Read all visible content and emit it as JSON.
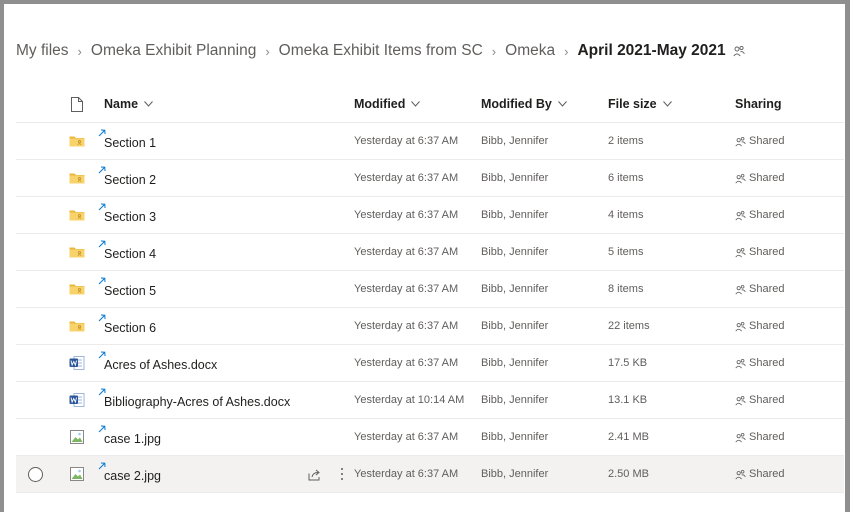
{
  "breadcrumb": {
    "items": [
      "My files",
      "Omeka Exhibit Planning",
      "Omeka Exhibit Items from SC",
      "Omeka"
    ],
    "current": "April 2021-May 2021"
  },
  "columns": {
    "name": "Name",
    "modified": "Modified",
    "modified_by": "Modified By",
    "file_size": "File size",
    "sharing": "Sharing"
  },
  "files": [
    {
      "name": "Section 1",
      "type": "folder",
      "modified": "Yesterday at 6:37 AM",
      "modified_by": "Bibb, Jennifer",
      "size": "2 items",
      "sharing": "Shared"
    },
    {
      "name": "Section 2",
      "type": "folder",
      "modified": "Yesterday at 6:37 AM",
      "modified_by": "Bibb, Jennifer",
      "size": "6 items",
      "sharing": "Shared"
    },
    {
      "name": "Section 3",
      "type": "folder",
      "modified": "Yesterday at 6:37 AM",
      "modified_by": "Bibb, Jennifer",
      "size": "4 items",
      "sharing": "Shared"
    },
    {
      "name": "Section 4",
      "type": "folder",
      "modified": "Yesterday at 6:37 AM",
      "modified_by": "Bibb, Jennifer",
      "size": "5 items",
      "sharing": "Shared"
    },
    {
      "name": "Section 5",
      "type": "folder",
      "modified": "Yesterday at 6:37 AM",
      "modified_by": "Bibb, Jennifer",
      "size": "8 items",
      "sharing": "Shared"
    },
    {
      "name": "Section 6",
      "type": "folder",
      "modified": "Yesterday at 6:37 AM",
      "modified_by": "Bibb, Jennifer",
      "size": "22 items",
      "sharing": "Shared"
    },
    {
      "name": "Acres of Ashes.docx",
      "type": "word",
      "modified": "Yesterday at 6:37 AM",
      "modified_by": "Bibb, Jennifer",
      "size": "17.5 KB",
      "sharing": "Shared"
    },
    {
      "name": "Bibliography-Acres of Ashes.docx",
      "type": "word",
      "modified": "Yesterday at 10:14 AM",
      "modified_by": "Bibb, Jennifer",
      "size": "13.1 KB",
      "sharing": "Shared"
    },
    {
      "name": "case 1.jpg",
      "type": "image",
      "modified": "Yesterday at 6:37 AM",
      "modified_by": "Bibb, Jennifer",
      "size": "2.41 MB",
      "sharing": "Shared"
    },
    {
      "name": "case 2.jpg",
      "type": "image",
      "modified": "Yesterday at 6:37 AM",
      "modified_by": "Bibb, Jennifer",
      "size": "2.50 MB",
      "sharing": "Shared",
      "hovered": true
    }
  ],
  "colors": {
    "folder": "#f8d36b",
    "word": "#2b579a",
    "new_indicator": "#0078d4",
    "row_hover": "#f3f2f1"
  }
}
